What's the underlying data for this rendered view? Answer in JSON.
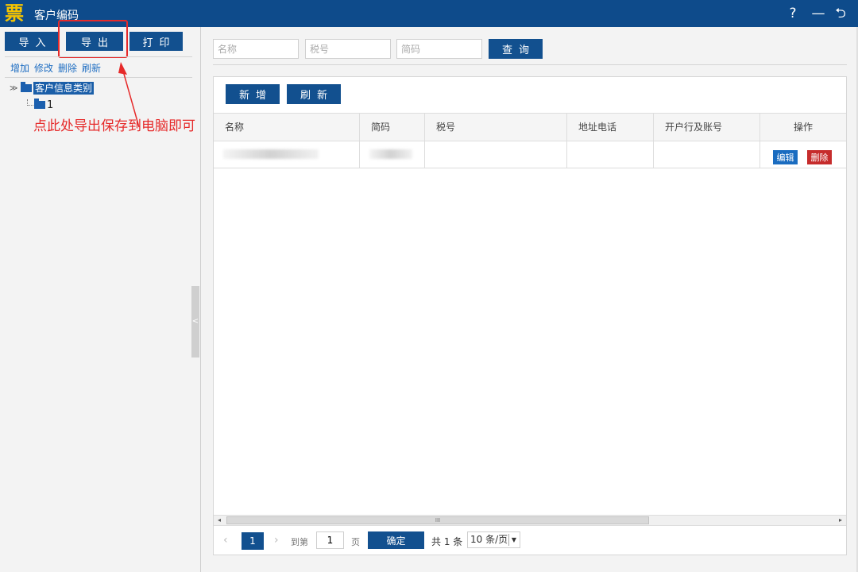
{
  "app": {
    "logo": "票",
    "title": "客户编码"
  },
  "window_controls": {
    "help": "?",
    "minimize": "—",
    "back": "⮌"
  },
  "left_panel": {
    "buttons": {
      "import": "导入",
      "export": "导出",
      "print": "打印"
    },
    "actions": [
      "增加",
      "修改",
      "删除",
      "刷新"
    ],
    "tree": {
      "toggle": "≫",
      "root": "客户信息类别",
      "children": [
        "1"
      ]
    },
    "annotation": "点此处导出保存到电脑即可",
    "collapse_handle": "<"
  },
  "search": {
    "name_placeholder": "名称",
    "tax_placeholder": "税号",
    "abbr_placeholder": "简码",
    "query_label": "查询"
  },
  "toolbar": {
    "add_label": "新增",
    "refresh_label": "刷新"
  },
  "table": {
    "headers": [
      "名称",
      "简码",
      "税号",
      "地址电话",
      "开户行及账号",
      "操作"
    ],
    "rows": [
      {
        "edit_label": "编辑",
        "delete_label": "删除"
      }
    ]
  },
  "scrollbar": {
    "left": "◂",
    "right": "▸",
    "thumb": "III"
  },
  "pager": {
    "prev": "‹",
    "current_page": "1",
    "next": "›",
    "goto_label": "到第",
    "goto_value": "1",
    "page_label": "页",
    "confirm_label": "确定",
    "total_label": "共 1 条",
    "page_size": "10 条/页",
    "page_size_arrow": "▼"
  },
  "colors": {
    "titlebar": "#0e4b8b",
    "button": "#12508f",
    "delete": "#c62c2c",
    "edit": "#1a6cc0",
    "annotation": "#e62a2a"
  }
}
